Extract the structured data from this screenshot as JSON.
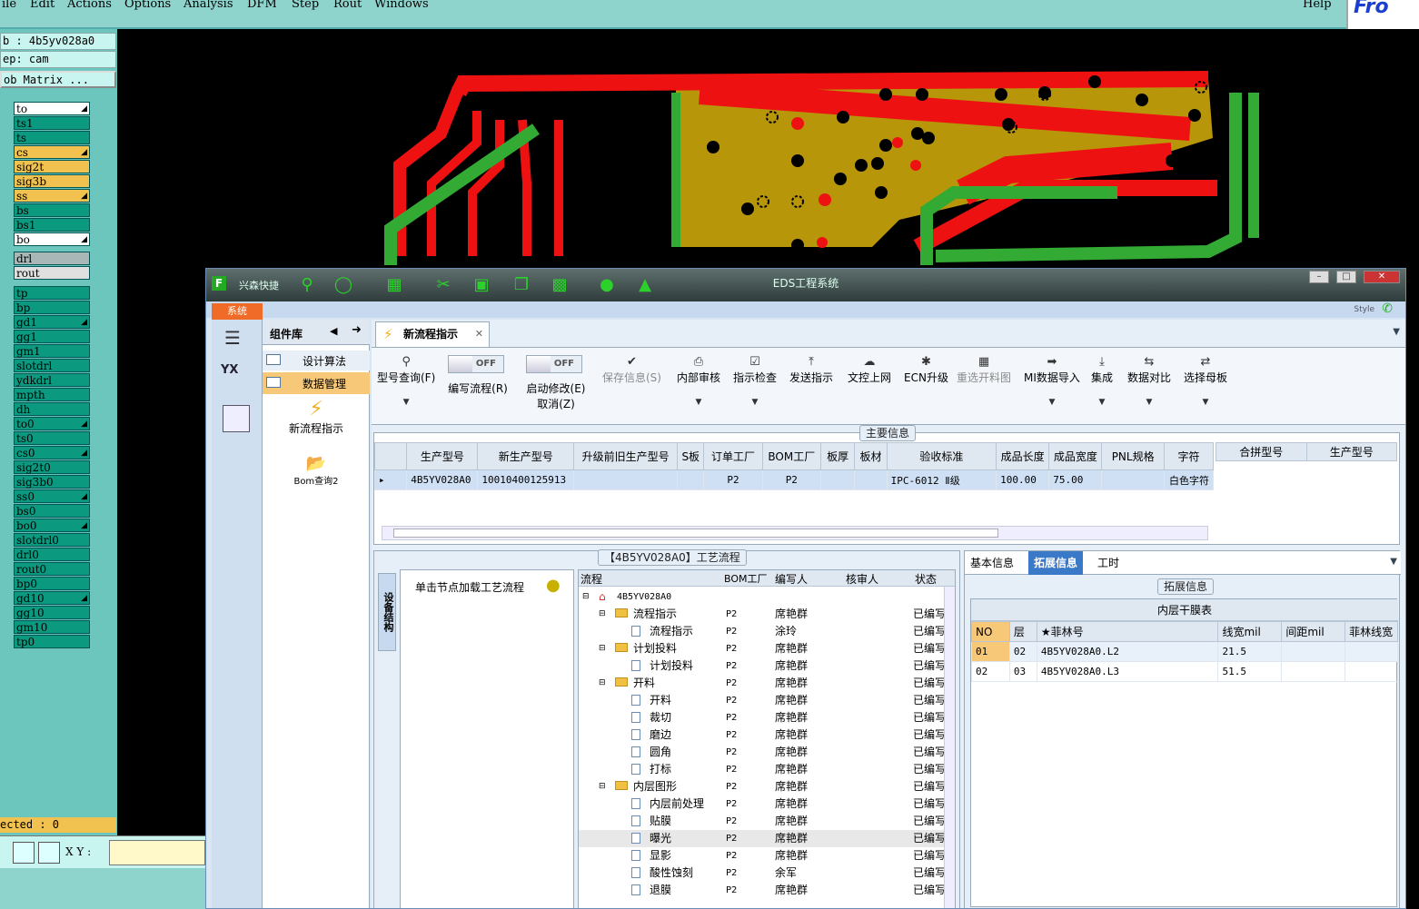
{
  "menubar": {
    "items": [
      "ile",
      "Edit",
      "Actions",
      "Options",
      "Analysis",
      "DFM",
      "Step",
      "Rout",
      "Windows"
    ],
    "help": "Help",
    "logo": "Fro"
  },
  "leftpanel": {
    "job": "b : 4b5yv028a0",
    "step": "ep: cam",
    "matrix": "ob Matrix ...",
    "layers": [
      {
        "name": "to",
        "color": "#ffffff",
        "tri": true
      },
      {
        "name": "ts1",
        "color": "#0b9a80",
        "tri": false
      },
      {
        "name": "ts",
        "color": "#0b9a80",
        "tri": false
      },
      {
        "name": "cs",
        "color": "#f1c24f",
        "tri": true
      },
      {
        "name": "sig2t",
        "color": "#f1c24f",
        "tri": false
      },
      {
        "name": "sig3b",
        "color": "#f1c24f",
        "tri": false
      },
      {
        "name": "ss",
        "color": "#f1c24f",
        "tri": true
      },
      {
        "name": "bs",
        "color": "#0b9a80",
        "tri": false
      },
      {
        "name": "bs1",
        "color": "#0b9a80",
        "tri": false
      },
      {
        "name": "bo",
        "color": "#ffffff",
        "tri": true
      }
    ],
    "layers2": [
      {
        "name": "drl",
        "color": "#a9b8b6"
      },
      {
        "name": "rout",
        "color": "#e0e0e0"
      }
    ],
    "layers3": [
      {
        "name": "tp",
        "tri": false
      },
      {
        "name": "bp",
        "tri": false
      },
      {
        "name": "gd1",
        "tri": true
      },
      {
        "name": "gg1",
        "tri": false
      },
      {
        "name": "gm1",
        "tri": false
      },
      {
        "name": "slotdrl",
        "tri": false
      },
      {
        "name": "ydkdrl",
        "tri": false
      },
      {
        "name": "mpth",
        "tri": false
      },
      {
        "name": "dh",
        "tri": false
      },
      {
        "name": "to0",
        "tri": true
      },
      {
        "name": "ts0",
        "tri": false
      },
      {
        "name": "cs0",
        "tri": true
      },
      {
        "name": "sig2t0",
        "tri": false
      },
      {
        "name": "sig3b0",
        "tri": false
      },
      {
        "name": "ss0",
        "tri": true
      },
      {
        "name": "bs0",
        "tri": false
      },
      {
        "name": "bo0",
        "tri": true
      },
      {
        "name": "slotdrl0",
        "tri": false
      },
      {
        "name": "drl0",
        "tri": false
      },
      {
        "name": "rout0",
        "tri": false
      },
      {
        "name": "bp0",
        "tri": false
      },
      {
        "name": "gd10",
        "tri": true
      },
      {
        "name": "gg10",
        "tri": false
      },
      {
        "name": "gm10",
        "tri": false
      },
      {
        "name": "tp0",
        "tri": false
      }
    ],
    "selected": "ected : 0",
    "xy_label": "X Y :"
  },
  "window": {
    "title": "EDS工程系统",
    "quick_label": "兴森快捷",
    "system_tab": "系统",
    "style_label": "Style",
    "component_lib": "组件库",
    "sidebar_items": [
      "设计算法",
      "数据管理"
    ],
    "sidebar_actions": [
      "新流程指示",
      "Bom查询2"
    ],
    "doc_tab": "新流程指示",
    "tools": [
      {
        "label": "型号查询(F)",
        "icon": "search-icon",
        "disabled": false
      },
      {
        "label": "编写流程(R)",
        "icon": "switch",
        "disabled": false
      },
      {
        "label": "启动修改(E)",
        "icon": "switch",
        "disabled": false
      },
      {
        "label": "保存信息(S)",
        "icon": "check-icon",
        "disabled": true
      },
      {
        "label": "内部审核",
        "icon": "print-icon",
        "disabled": false
      },
      {
        "label": "指示检查",
        "icon": "checkbox-icon",
        "disabled": false
      },
      {
        "label": "发送指示",
        "icon": "upload-icon",
        "disabled": false
      },
      {
        "label": "文控上网",
        "icon": "cloud-icon",
        "disabled": false
      },
      {
        "label": "ECN升级",
        "icon": "ecn-icon",
        "disabled": false
      },
      {
        "label": "重选开料图",
        "icon": "image-icon",
        "disabled": true
      },
      {
        "label": "MI数据导入",
        "icon": "import-icon",
        "disabled": false
      },
      {
        "label": "集成",
        "icon": "download-icon",
        "disabled": false
      },
      {
        "label": "数据对比",
        "icon": "compare-icon",
        "disabled": false
      },
      {
        "label": "选择母板",
        "icon": "shuffle-icon",
        "disabled": false
      }
    ],
    "switch_off": "OFF",
    "cancel_label": "取消(Z)"
  },
  "main_info": {
    "legend": "主要信息",
    "columns": [
      "生产型号",
      "新生产型号",
      "升级前旧生产型号",
      "S板",
      "订单工厂",
      "BOM工厂",
      "板厚",
      "板材",
      "验收标准",
      "成品长度",
      "成品宽度",
      "PNL规格",
      "字符"
    ],
    "row": [
      "4B5YV028A0",
      "10010400125913",
      "",
      "",
      "P2",
      "P2",
      "",
      "",
      "IPC-6012 Ⅱ级",
      "100.00",
      "75.00",
      "",
      "白色字符"
    ],
    "side_columns": [
      "合拼型号",
      "生产型号"
    ]
  },
  "process": {
    "legend": "【4B5YV028A0】工艺流程",
    "side_tab": "设备结构",
    "hint": "单击节点加载工艺流程",
    "columns": [
      "流程",
      "BOM工厂",
      "编写人",
      "核审人",
      "状态"
    ],
    "rows": [
      {
        "level": 0,
        "type": "home",
        "name": "4B5YV028A0",
        "bom": "",
        "writer": "",
        "status": ""
      },
      {
        "level": 1,
        "type": "folder",
        "name": "流程指示",
        "bom": "P2",
        "writer": "席艳群",
        "status": "已编写"
      },
      {
        "level": 2,
        "type": "doc",
        "name": "流程指示",
        "bom": "P2",
        "writer": "涂玲",
        "status": "已编写"
      },
      {
        "level": 1,
        "type": "folder",
        "name": "计划投料",
        "bom": "P2",
        "writer": "席艳群",
        "status": "已编写"
      },
      {
        "level": 2,
        "type": "doc",
        "name": "计划投料",
        "bom": "P2",
        "writer": "席艳群",
        "status": "已编写"
      },
      {
        "level": 1,
        "type": "folder",
        "name": "开料",
        "bom": "P2",
        "writer": "席艳群",
        "status": "已编写"
      },
      {
        "level": 2,
        "type": "doc",
        "name": "开料",
        "bom": "P2",
        "writer": "席艳群",
        "status": "已编写"
      },
      {
        "level": 2,
        "type": "doc",
        "name": "裁切",
        "bom": "P2",
        "writer": "席艳群",
        "status": "已编写"
      },
      {
        "level": 2,
        "type": "doc",
        "name": "磨边",
        "bom": "P2",
        "writer": "席艳群",
        "status": "已编写"
      },
      {
        "level": 2,
        "type": "doc",
        "name": "圆角",
        "bom": "P2",
        "writer": "席艳群",
        "status": "已编写"
      },
      {
        "level": 2,
        "type": "doc",
        "name": "打标",
        "bom": "P2",
        "writer": "席艳群",
        "status": "已编写"
      },
      {
        "level": 1,
        "type": "folder",
        "name": "内层图形",
        "bom": "P2",
        "writer": "席艳群",
        "status": "已编写"
      },
      {
        "level": 2,
        "type": "doc",
        "name": "内层前处理",
        "bom": "P2",
        "writer": "席艳群",
        "status": "已编写"
      },
      {
        "level": 2,
        "type": "doc",
        "name": "贴膜",
        "bom": "P2",
        "writer": "席艳群",
        "status": "已编写"
      },
      {
        "level": 2,
        "type": "doc",
        "name": "曝光",
        "bom": "P2",
        "writer": "席艳群",
        "status": "已编写",
        "selected": true
      },
      {
        "level": 2,
        "type": "doc",
        "name": "显影",
        "bom": "P2",
        "writer": "席艳群",
        "status": "已编写"
      },
      {
        "level": 2,
        "type": "doc",
        "name": "酸性蚀刻",
        "bom": "P2",
        "writer": "余军",
        "status": "已编写"
      },
      {
        "level": 2,
        "type": "doc",
        "name": "退膜",
        "bom": "P2",
        "writer": "席艳群",
        "status": "已编写"
      }
    ]
  },
  "right_panel": {
    "tabs": [
      "基本信息",
      "拓展信息",
      "工时"
    ],
    "active_tab": 1,
    "legend": "拓展信息",
    "table_title": "内层干膜表",
    "columns": [
      "NO",
      "层",
      "★菲林号",
      "线宽mil",
      "间距mil",
      "菲林线宽"
    ],
    "rows": [
      [
        "01",
        "02",
        "4B5YV028A0.L2",
        "21.5",
        "",
        ""
      ],
      [
        "02",
        "03",
        "4B5YV028A0.L3",
        "51.5",
        "",
        ""
      ]
    ]
  }
}
